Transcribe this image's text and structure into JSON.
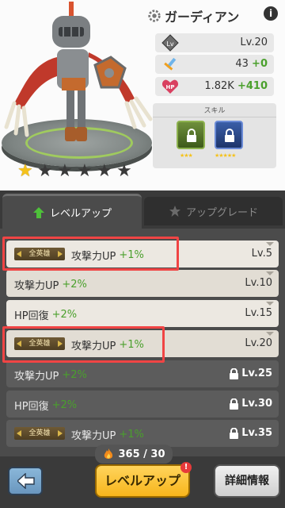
{
  "hero": {
    "name": "ガーディアン",
    "stars_total": 6,
    "stars_filled": 1
  },
  "stats": {
    "level": "Lv.20",
    "attack_value": "43",
    "attack_bonus": "+0",
    "hp_value": "1.82K",
    "hp_bonus": "+410",
    "lv_icon_text": "Lv",
    "hp_icon_text": "HP"
  },
  "skills": {
    "title": "スキル",
    "items": [
      {
        "stars": "★★★",
        "color": "#6f8f3c"
      },
      {
        "stars": "★★★★★",
        "color": "#3a5ea8"
      }
    ]
  },
  "tabs": {
    "levelup": "レベルアップ",
    "upgrade": "アップグレード"
  },
  "badge_label": "全英雄",
  "rows": [
    {
      "desc": "攻撃力UP",
      "bonus": "+1%",
      "level": "Lv.5",
      "badge": true,
      "locked": false
    },
    {
      "desc": "攻撃力UP",
      "bonus": "+2%",
      "level": "Lv.10",
      "badge": false,
      "locked": false
    },
    {
      "desc": "HP回復",
      "bonus": "+2%",
      "level": "Lv.15",
      "badge": false,
      "locked": false
    },
    {
      "desc": "攻撃力UP",
      "bonus": "+1%",
      "level": "Lv.20",
      "badge": true,
      "locked": false
    },
    {
      "desc": "攻撃力UP",
      "bonus": "+2%",
      "level": "Lv.25",
      "badge": false,
      "locked": true
    },
    {
      "desc": "HP回復",
      "bonus": "+2%",
      "level": "Lv.30",
      "badge": false,
      "locked": true
    },
    {
      "desc": "攻撃力UP",
      "bonus": "+1%",
      "level": "Lv.35",
      "badge": true,
      "locked": true
    }
  ],
  "bottom": {
    "currency": "365 / 30",
    "levelup_label": "レベルアップ",
    "alert": "!",
    "details_label": "詳細情報"
  },
  "colors": {
    "bonus_green": "#4aa02c",
    "highlight_red": "#f04444",
    "star_gold": "#f5c21b"
  }
}
